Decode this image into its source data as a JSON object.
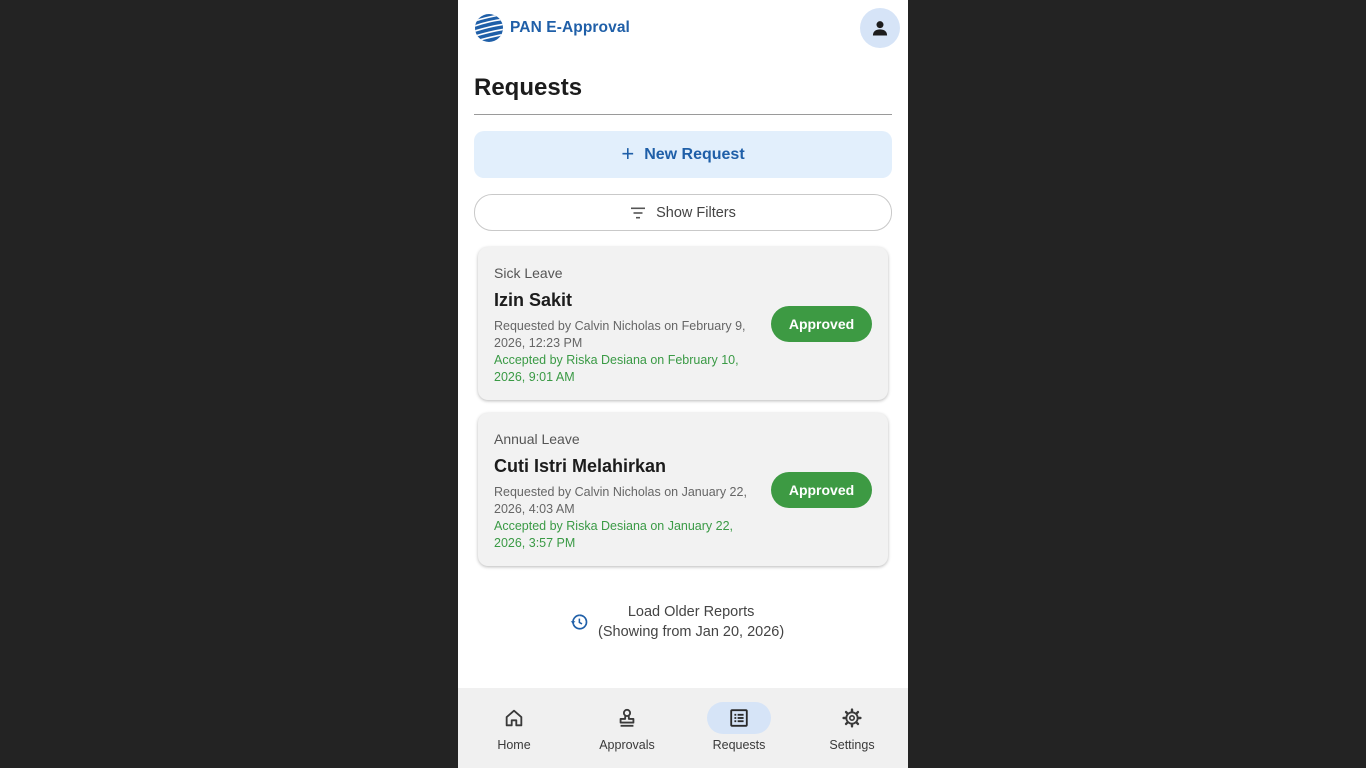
{
  "app": {
    "name": "PAN E-Approval",
    "logo_icon": "pan-globe-logo",
    "avatar_icon": "person-icon"
  },
  "page": {
    "title": "Requests"
  },
  "actions": {
    "new_request_label": "New Request",
    "new_request_icon": "plus-icon",
    "show_filters_label": "Show Filters",
    "filter_icon": "filter-icon"
  },
  "requests": [
    {
      "type": "Sick Leave",
      "title": "Izin Sakit",
      "requested": "Requested by Calvin Nicholas on February 9, 2026, 12:23 PM",
      "accepted": "Accepted by Riska Desiana on February 10, 2026, 9:01 AM",
      "status": "Approved"
    },
    {
      "type": "Annual Leave",
      "title": "Cuti Istri Melahirkan",
      "requested": "Requested by Calvin Nicholas on January 22, 2026, 4:03 AM",
      "accepted": "Accepted by Riska Desiana on January 22, 2026, 3:57 PM",
      "status": "Approved"
    }
  ],
  "load_older": {
    "label": "Load Older Reports",
    "sub": "(Showing from Jan 20, 2026)",
    "icon": "history-icon"
  },
  "nav": {
    "items": [
      {
        "label": "Home",
        "icon": "home-icon"
      },
      {
        "label": "Approvals",
        "icon": "stamp-icon"
      },
      {
        "label": "Requests",
        "icon": "list-icon",
        "active": true
      },
      {
        "label": "Settings",
        "icon": "gear-icon"
      }
    ]
  },
  "colors": {
    "brand": "#1f5fa8",
    "approved": "#3d9a43",
    "accepted_text": "#3a9a45",
    "active_pill": "#d6e4f7",
    "background": "#232323"
  }
}
